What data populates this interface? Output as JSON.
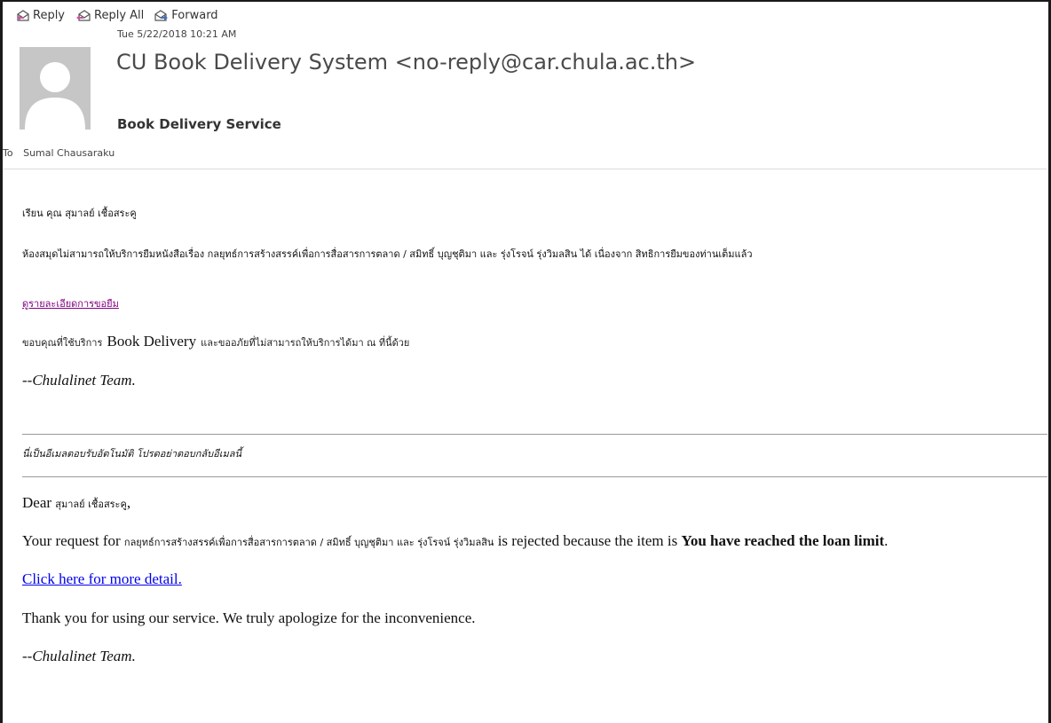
{
  "toolbar": {
    "reply": "Reply",
    "reply_all": "Reply All",
    "forward": "Forward",
    "icon_color": "#4a6fb5"
  },
  "header": {
    "date": "Tue 5/22/2018 10:21 AM",
    "sender": "CU Book Delivery System <no-reply@car.chula.ac.th>",
    "subject": "Book Delivery Service",
    "to_label": "To",
    "to_name": "Sumal Chausaraku"
  },
  "body_th": {
    "greeting": "เรียน คุณ สุมาลย์ เชื้อสระคู",
    "message": "ห้องสมุดไม่สามารถให้บริการยืมหนังสือเรื่อง กลยุทธ์การสร้างสรรค์เพื่อการสื่อสารการตลาด / สมิทธิ์ บุญชุติมา และ รุ่งโรจน์ รุ่งวิมลสิน ได้ เนื่องจาก สิทธิการยืมของท่านเต็มแล้ว",
    "link": "ดูรายละเอียดการขอยืม",
    "thanks_prefix": "ขอบคุณที่ใช้บริการ",
    "thanks_service": "Book Delivery",
    "thanks_suffix": "และขออภัยที่ไม่สามารถให้บริการได้มา ณ ที่นี้ด้วย",
    "signature": "--Chulalinet Team."
  },
  "auto_reply_note": "นี่เป็นอีเมลตอบรับอัตโนมัติ โปรดอย่าตอบกลับอีเมลนี้",
  "body_en": {
    "dear": "Dear",
    "name": "สุมาลย์ เชื้อสระคู",
    "dear_end": ",",
    "request_prefix": "Your request for",
    "request_title": "กลยุทธ์การสร้างสรรค์เพื่อการสื่อสารการตลาด / สมิทธิ์ บุญชุติมา และ รุ่งโรจน์ รุ่งวิมลสิน",
    "request_middle": "is rejected because the item is",
    "reason": "You have reached the loan limit",
    "request_end": ".",
    "link": "Click here for more detail.",
    "thanks": "Thank you for using our service. We truly apologize for the inconvenience.",
    "signature": "--Chulalinet Team."
  }
}
